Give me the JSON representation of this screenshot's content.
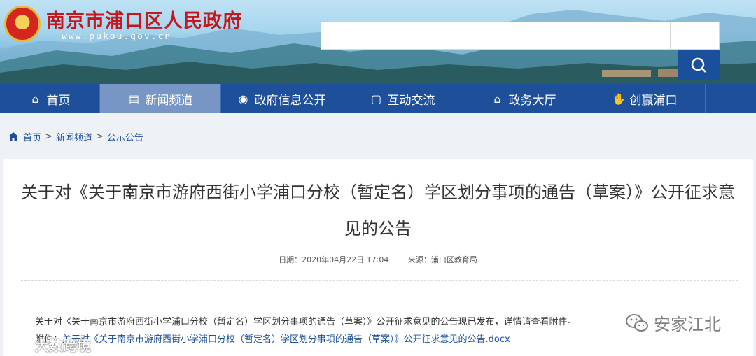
{
  "header": {
    "site_title": "南京市浦口区人民政府",
    "site_domain": "www.pukou.gov.cn",
    "search": {
      "placeholder": "",
      "value": ""
    }
  },
  "nav": {
    "items": [
      {
        "label": "首页",
        "icon": "home-icon",
        "active": false
      },
      {
        "label": "新闻频道",
        "icon": "news-icon",
        "active": true
      },
      {
        "label": "政府信息公开",
        "icon": "broadcast-icon",
        "active": false
      },
      {
        "label": "互动交流",
        "icon": "chat-icon",
        "active": false
      },
      {
        "label": "政务大厅",
        "icon": "building-icon",
        "active": false
      },
      {
        "label": "创赢浦口",
        "icon": "handshake-icon",
        "active": false
      }
    ]
  },
  "breadcrumb": {
    "items": [
      "首页",
      "新闻频道",
      "公示公告"
    ],
    "separator": ">"
  },
  "article": {
    "title": "关于对《关于南京市游府西街小学浦口分校（暂定名）学区划分事项的通告（草案）》公开征求意见的公告",
    "date_label": "日期：",
    "date": "2020年04月22日 17:04",
    "source_label": "来源：",
    "source": "浦口区教育局",
    "body": "关于对《关于南京市游府西街小学浦口分校（暂定名）学区划分事项的通告（草案）》公开征求意见的公告现已发布，详情请查看附件。",
    "attachment_label": "附件：",
    "attachment_link": "关于对《关于南京市游府西街小学浦口分校（暂定名）学区划分事项的通告（草案）》公开征求意见的公告.docx"
  },
  "watermarks": {
    "right": "安家江北",
    "left": "大数跨境"
  },
  "colors": {
    "nav_bg": "#1d4f9b",
    "nav_active": "#7796c6",
    "title_red": "#c8161d",
    "link_blue": "#1d4f9b"
  }
}
